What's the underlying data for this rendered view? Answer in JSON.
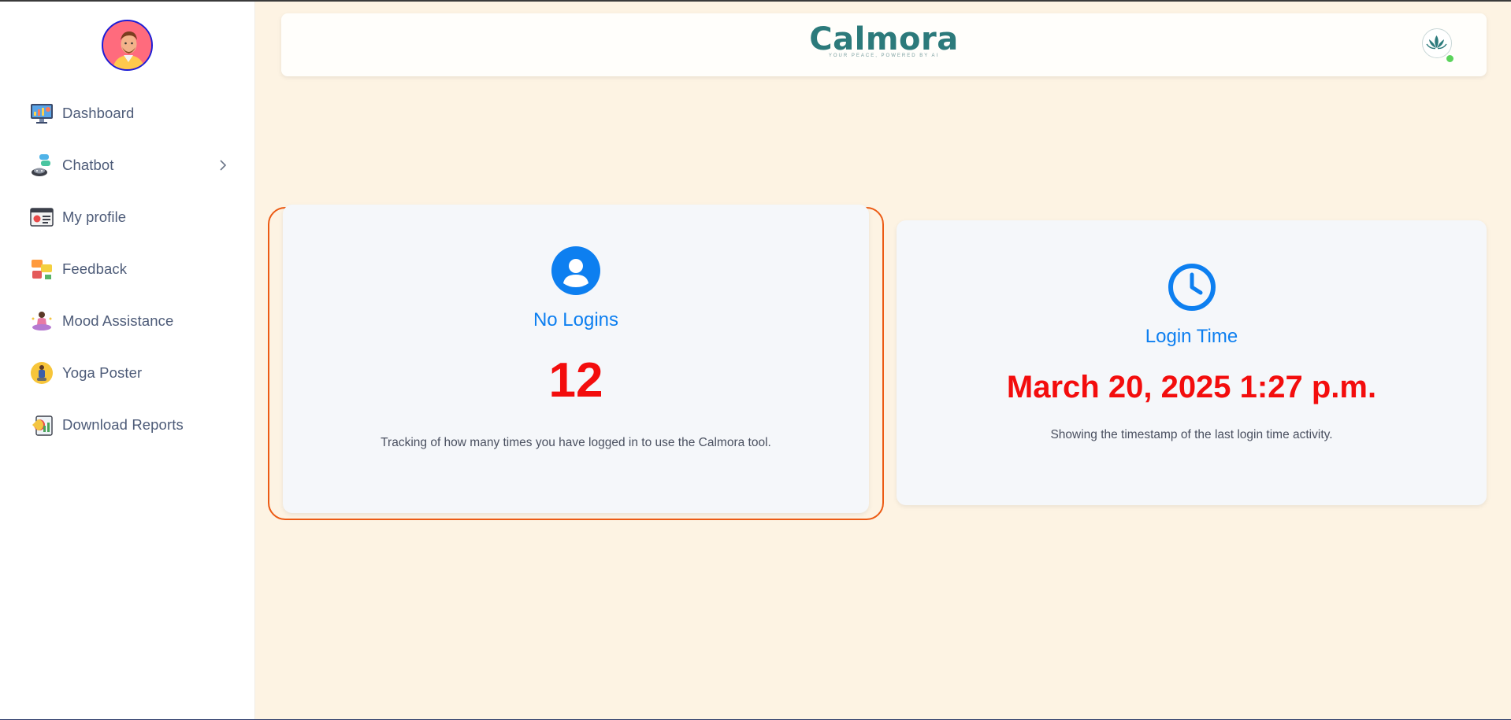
{
  "sidebar": {
    "items": [
      {
        "label": "Dashboard",
        "icon": "dashboard-icon"
      },
      {
        "label": "Chatbot",
        "icon": "chatbot-icon",
        "expandable": true
      },
      {
        "label": "My profile",
        "icon": "profile-icon"
      },
      {
        "label": "Feedback",
        "icon": "feedback-icon"
      },
      {
        "label": "Mood Assistance",
        "icon": "meditation-icon"
      },
      {
        "label": "Yoga Poster",
        "icon": "yoga-icon"
      },
      {
        "label": "Download Reports",
        "icon": "reports-icon"
      }
    ]
  },
  "header": {
    "brand": "Calmora",
    "tagline": "YOUR PEACE, POWERED BY AI",
    "status": "online"
  },
  "cards": [
    {
      "icon": "user-circle-icon",
      "title": "No Logins",
      "value": "12",
      "description": "Tracking of how many times you have logged in to use the Calmora tool."
    },
    {
      "icon": "clock-icon",
      "title": "Login Time",
      "value": "March 20, 2025 1:27 p.m.",
      "description": "Showing the timestamp of the last login time activity."
    }
  ],
  "colors": {
    "background": "#fdf3e3",
    "brand": "#2c7a7b",
    "accent_blue": "#0d7ff0",
    "value_red": "#f30d0d",
    "highlight_outline": "#ec5a13"
  }
}
